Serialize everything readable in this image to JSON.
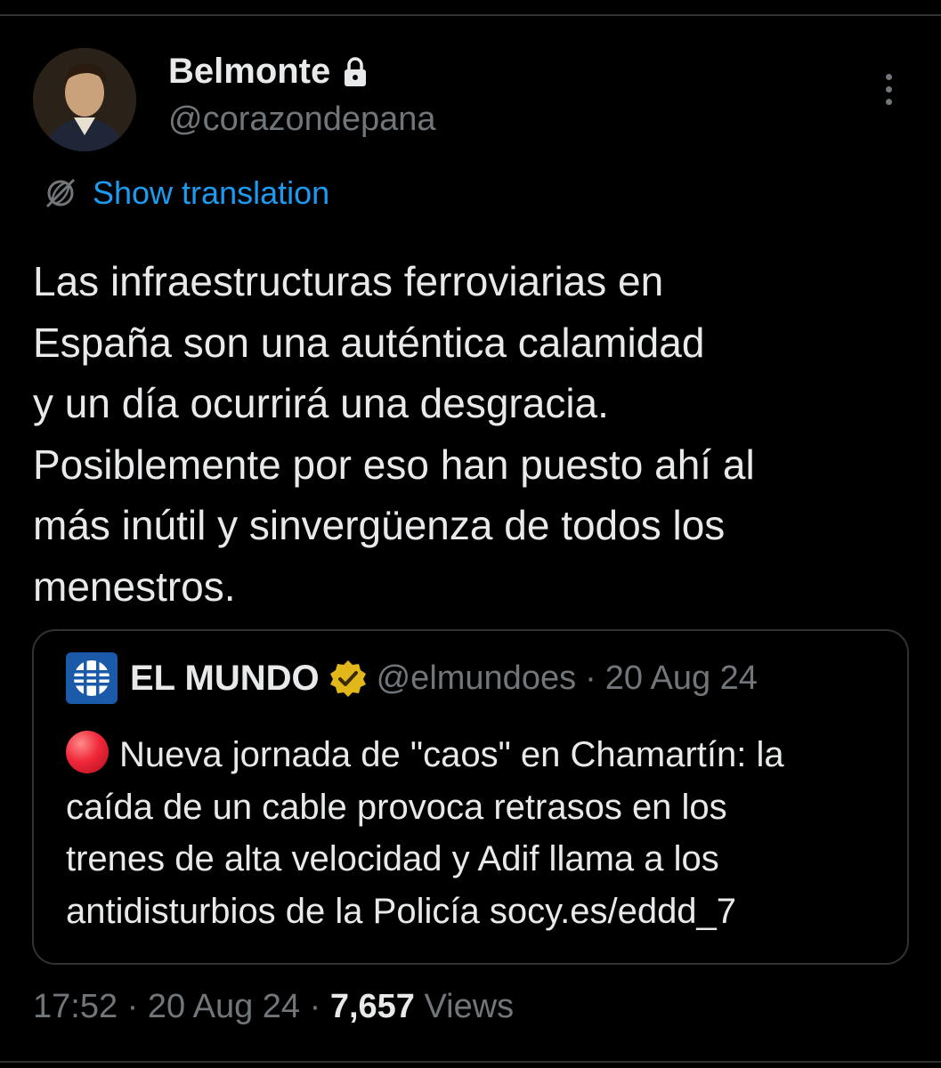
{
  "author": {
    "display_name": "Belmonte",
    "handle": "@corazondepana",
    "protected_icon": "lock-icon"
  },
  "more_icon": "more-vertical-icon",
  "translation": {
    "icon": "translate-globe-icon",
    "label": "Show translation"
  },
  "tweet": {
    "lines": [
      "Las infraestructuras ferroviarias en",
      "España son una auténtica calamidad",
      "y un día ocurrirá una desgracia.",
      "Posiblemente por eso han puesto ahí al",
      "más inútil y sinvergüenza de todos los",
      "menestros."
    ]
  },
  "quote": {
    "logo_icon": "el-mundo-logo",
    "name": "EL MUNDO",
    "verified_icon": "gold-verified-badge-icon",
    "handle": "@elmundoes",
    "separator": "·",
    "date": "20 Aug 24",
    "emoji": "red-circle-icon",
    "lines": [
      "Nueva jornada de \"caos\" en Chamartín: la",
      "caída de un cable provoca retrasos en los",
      "trenes de alta velocidad y Adif llama a los",
      "antidisturbios de la Policía socy.es/eddd_7"
    ]
  },
  "footer": {
    "time": "17:52",
    "separator": "·",
    "date": "20 Aug 24",
    "views_count": "7,657",
    "views_label": "Views"
  },
  "colors": {
    "background": "#000000",
    "primary_text": "#e7e9ea",
    "secondary_text": "#71767b",
    "link": "#1d9bf0",
    "border": "#2f3336",
    "verified_gold": "#e2b719"
  }
}
